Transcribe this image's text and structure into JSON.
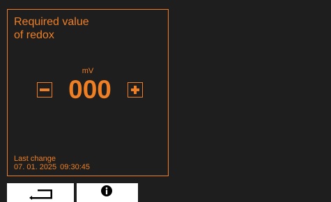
{
  "panel": {
    "title_line1": "Required value",
    "title_line2": "of redox",
    "unit": "mV",
    "value": "000",
    "last_change_label": "Last change",
    "last_change_date": "07. 01. 2025",
    "last_change_time": "09:30:45"
  },
  "stepper": {
    "minus_icon": "minus-icon",
    "plus_icon": "plus-icon"
  },
  "bottom_bar": {
    "back_icon": "back-arrow-icon",
    "info_icon": "info-icon"
  },
  "colors": {
    "accent": "#f07f24",
    "background": "#1e1e1e",
    "button_bg": "#ffffff"
  }
}
